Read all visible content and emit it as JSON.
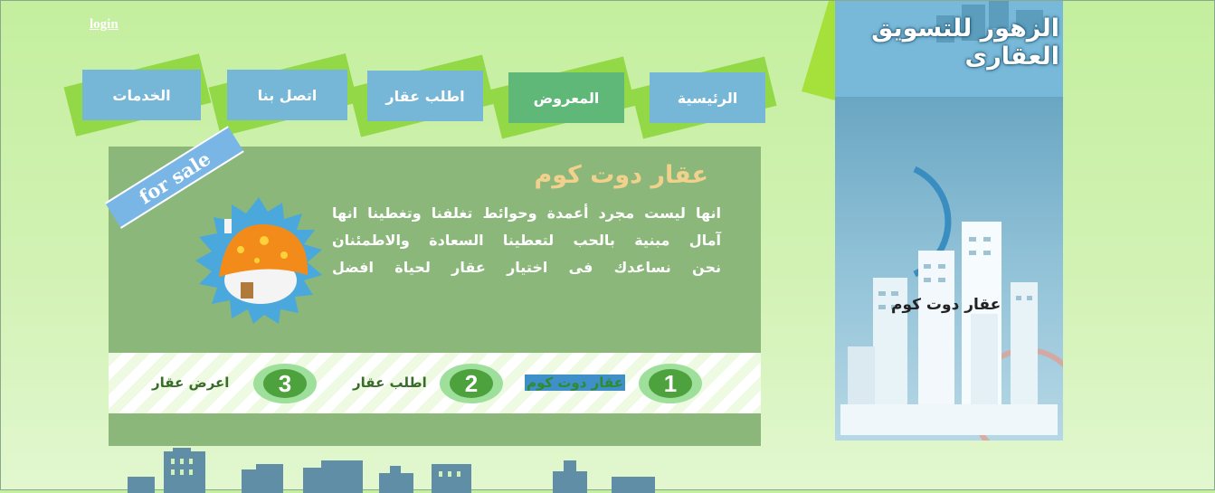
{
  "header": {
    "login": "login"
  },
  "nav": [
    {
      "label": "الرئيسية",
      "active": false
    },
    {
      "label": "المعروض",
      "active": true
    },
    {
      "label": "اطلب عقار",
      "active": false
    },
    {
      "label": "اتصل بنا",
      "active": false
    },
    {
      "label": "الخدمات",
      "active": false
    }
  ],
  "brand": {
    "logo_text": "الزهور للتسويق العقارى",
    "city_label": "عقار دوت كوم"
  },
  "hero": {
    "badge": "for sale",
    "title": "عقار دوت كوم",
    "lines": [
      "انها ليست مجرد أعمدة وحوائط تغلفنا وتغطينا انها",
      "آمال مبنية بالحب لتعطينا السعادة والاطمئنان",
      "نحن نساعدك فى اختيار عقار لحياة افضل"
    ]
  },
  "steps": [
    {
      "num": "1",
      "label": "عقار دوت كوم"
    },
    {
      "num": "2",
      "label": "اطلب عقار"
    },
    {
      "num": "3",
      "label": "اعرض عقار"
    }
  ],
  "colors": {
    "accent_green": "#93d846",
    "nav_blue": "#76b6d6",
    "nav_active": "#60b878"
  }
}
